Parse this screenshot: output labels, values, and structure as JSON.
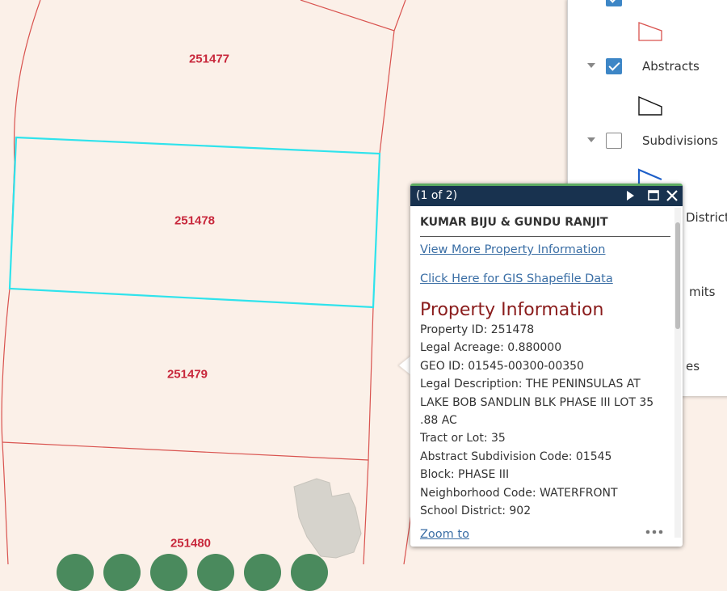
{
  "map": {
    "parcels": [
      {
        "id": "251477",
        "selected": false
      },
      {
        "id": "251478",
        "selected": true
      },
      {
        "id": "251479",
        "selected": false
      },
      {
        "id": "251480",
        "selected": false
      }
    ],
    "colors": {
      "land": "#fbf0e8",
      "parcel_line": "#d9534f",
      "selected_outline": "#2fe3ec",
      "label": "#c8283c",
      "building": "#d6d3cc"
    }
  },
  "layers": {
    "items": [
      {
        "label": "Abstracts",
        "checked": true
      },
      {
        "label": "Subdivisions",
        "checked": false
      }
    ],
    "partial_labels": [
      "District",
      "mits",
      "es"
    ]
  },
  "popup": {
    "counter": "(1 of 2)",
    "owner": "KUMAR BIJU & GUNDU RANJIT",
    "link_more": "View More Property Information",
    "link_gis": "Click Here for GIS Shapefile Data",
    "section_title": "Property Information",
    "fields": [
      "Property ID: 251478",
      "Legal Acreage: 0.880000",
      "GEO ID: 01545-00300-00350",
      "Legal Description: THE PENINSULAS AT",
      "LAKE BOB SANDLIN BLK PHASE III LOT 35",
      ".88 AC",
      "Tract or Lot: 35",
      "Abstract Subdivision Code: 01545",
      "Block: PHASE III",
      "Neighborhood Code: WATERFRONT",
      "School District: 902"
    ],
    "zoom_to": "Zoom to",
    "header_color": "#18324f",
    "accent_color": "#5dab62",
    "title_color": "#8a1c1c",
    "link_color": "#3a6ea5"
  },
  "toolbar": {
    "button_color": "#4a8a5d",
    "buttons": [
      "tool-1",
      "tool-2",
      "tool-3",
      "tool-4",
      "tool-5",
      "tool-6"
    ]
  }
}
